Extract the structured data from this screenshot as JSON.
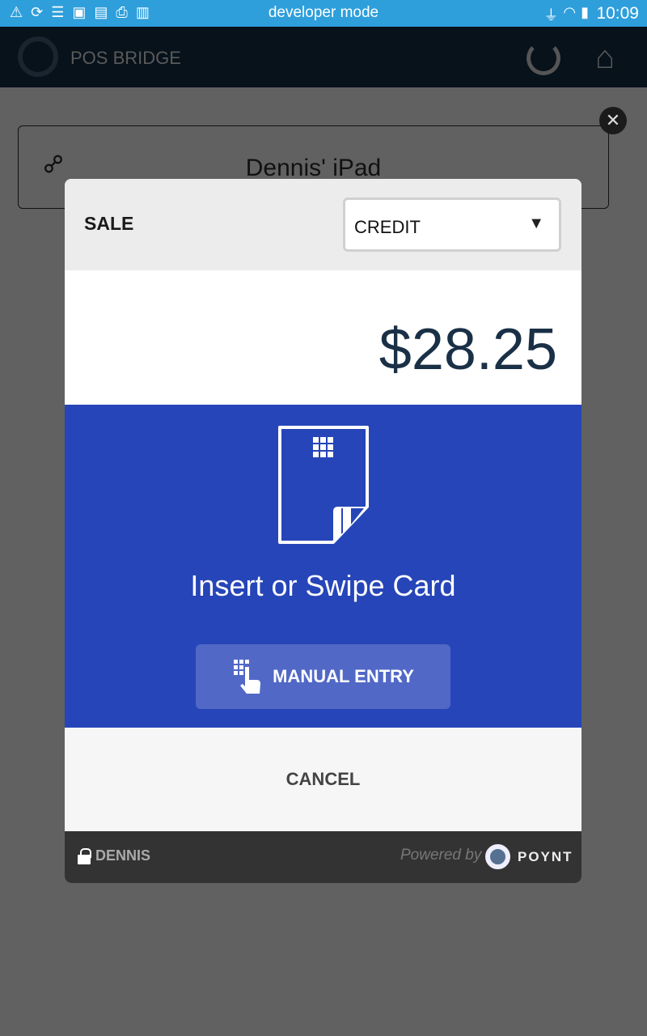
{
  "status_bar": {
    "title": "developer mode",
    "time": "10:09",
    "left_icons": [
      "warning-icon",
      "sync-icon",
      "list-icon",
      "screen-icon",
      "card-check-icon",
      "printer-check-icon",
      "barcode-icon"
    ],
    "right_icons": [
      "usb-icon",
      "wifi-icon",
      "battery-charging-icon"
    ]
  },
  "app_bar": {
    "title": "POS BRIDGE"
  },
  "connection": {
    "device_name": "Dennis' iPad"
  },
  "dialog": {
    "transaction_type": "SALE",
    "payment_method": {
      "selected": "CREDIT"
    },
    "amount": "$28.25",
    "prompt": "Insert or Swipe Card",
    "manual_entry_label": "MANUAL ENTRY",
    "cancel_label": "CANCEL",
    "footer": {
      "user": "DENNIS",
      "powered_by": "Powered by",
      "brand": "POYNT"
    },
    "colors": {
      "accent": "#2645b8",
      "button": "#5168c6"
    }
  }
}
